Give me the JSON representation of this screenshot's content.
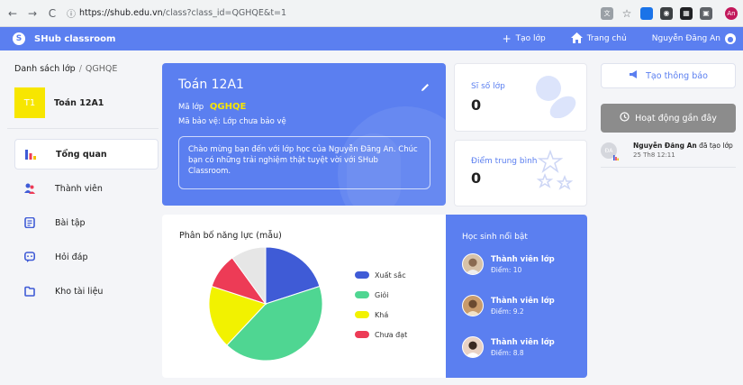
{
  "browser": {
    "url_host": "https://shub.edu.vn",
    "url_rest": "/class?class_id=QGHQE&t=1",
    "profile_initials": "An"
  },
  "header": {
    "brand": "SHub classroom",
    "create_class": "Tạo lớp",
    "home": "Trang chủ",
    "user_name": "Nguyễn Đăng An"
  },
  "sidebar": {
    "breadcrumb_root": "Danh sách lớp",
    "breadcrumb_sep": "/",
    "breadcrumb_current": "QGHQE",
    "class_initials": "T1",
    "class_name": "Toán 12A1",
    "items": [
      {
        "label": "Tổng quan"
      },
      {
        "label": "Thành viên"
      },
      {
        "label": "Bài tập"
      },
      {
        "label": "Hỏi đáp"
      },
      {
        "label": "Kho tài liệu"
      }
    ]
  },
  "class_card": {
    "title": "Toán 12A1",
    "code_label": "Mã lớp",
    "code_value": "QGHQE",
    "protect_label": "Mã bảo vệ: Lớp chưa bảo vệ",
    "welcome": "Chào mừng bạn đến với lớp học của Nguyễn Đăng An. Chúc bạn có những trải nghiệm thật tuyệt vời với SHub Classroom."
  },
  "stats": {
    "size_label": "Sĩ số lớp",
    "size_value": "0",
    "avg_label": "Điểm trung bình",
    "avg_value": "0"
  },
  "chart_data": {
    "type": "pie",
    "title": "Phân bố năng lực (mẫu)",
    "categories": [
      "Xuất sắc",
      "Giỏi",
      "Khá",
      "Chưa đạt"
    ],
    "values": [
      20,
      42,
      18,
      10,
      10
    ],
    "slice_labels": [
      "Xuất sắc",
      "Giỏi",
      "Khá",
      "Chưa đạt",
      ""
    ],
    "colors": [
      "#3f5bd6",
      "#4fd692",
      "#f2f200",
      "#ed3b56",
      "#e6e6e6"
    ]
  },
  "top_students": {
    "title": "Học sinh nổi bật",
    "items": [
      {
        "name": "Thành viên lớp",
        "score": "Điểm: 10"
      },
      {
        "name": "Thành viên lớp",
        "score": "Điểm: 9.2"
      },
      {
        "name": "Thành viên lớp",
        "score": "Điểm: 8.8"
      }
    ]
  },
  "right": {
    "notify_label": "Tạo thông báo",
    "activity_label": "Hoạt động gần đây",
    "feed": [
      {
        "avatar": "ĐA",
        "actor": "Nguyễn Đăng An",
        "action": "đã tạo lớp",
        "time": "25 Th8 12:11"
      }
    ]
  },
  "colors": {
    "primary": "#5b7ff0",
    "accent_yellow": "#f7e600"
  }
}
